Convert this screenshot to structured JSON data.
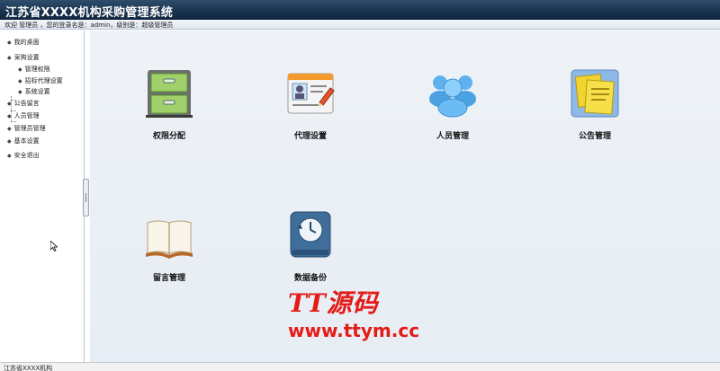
{
  "app": {
    "title": "江苏省XXXX机构采购管理系统",
    "welcome": "欢迎 管理员 ，您的登录名是：admin，级别是：超级管理员"
  },
  "sidebar": {
    "items": [
      {
        "label": "我的桌面"
      },
      {
        "label": "采购设置"
      },
      {
        "label": "管理权限"
      },
      {
        "label": "招标代理设置"
      },
      {
        "label": "系统设置"
      },
      {
        "label": "公告留言"
      },
      {
        "label": "人员管理"
      },
      {
        "label": "管理员管理"
      },
      {
        "label": "基本设置"
      },
      {
        "label": "安全退出"
      }
    ]
  },
  "tiles": [
    {
      "label": "权限分配",
      "icon": "cabinet-icon"
    },
    {
      "label": "代理设置",
      "icon": "id-card-icon"
    },
    {
      "label": "人员管理",
      "icon": "users-icon"
    },
    {
      "label": "公告管理",
      "icon": "notes-icon"
    },
    {
      "label": "留言管理",
      "icon": "book-icon"
    },
    {
      "label": "数据备份",
      "icon": "backup-drive-icon"
    }
  ],
  "watermark": {
    "logo": "TT源码",
    "url": "www.ttym.cc"
  },
  "statusbar": {
    "text": "江苏省XXXX机构"
  },
  "colors": {
    "titlebar": "#1a3450",
    "watermark": "#e41b17",
    "main_bg": "#eef2f7"
  }
}
